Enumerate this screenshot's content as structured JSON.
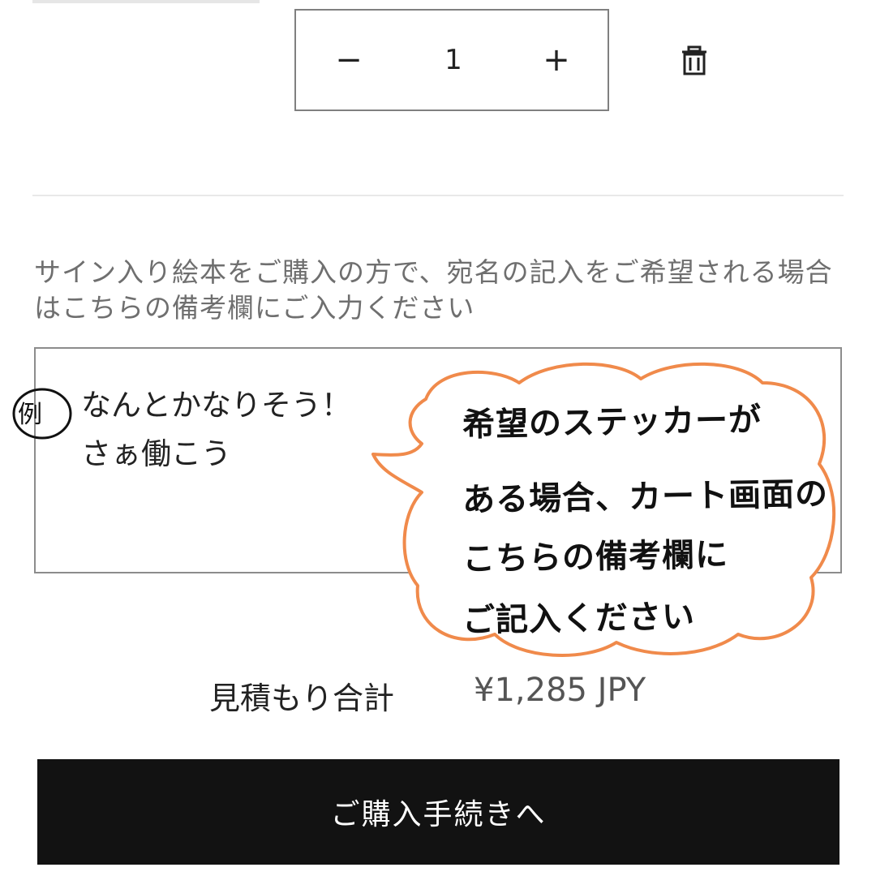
{
  "cart": {
    "quantity": {
      "minus_label": "−",
      "value": "1",
      "plus_label": "+"
    },
    "remove_icon": "trash-icon"
  },
  "note": {
    "label": "サイン入り絵本をご購入の方で、宛名の記入をご希望される場合はこちらの備考欄にご入力ください",
    "value_line1": "なんとかなりそう！",
    "value_line2": "さぁ働こう"
  },
  "annotation": {
    "example_mark": "例",
    "bubble_lines": [
      "希望のステッカーが",
      "ある場合、カート画面の",
      "こちらの備考欄に",
      "ご記入ください"
    ],
    "bubble_border_color": "#f08a4b"
  },
  "summary": {
    "label": "見積もり合計",
    "value": "¥1,285 JPY"
  },
  "checkout": {
    "label": "ご購入手続きへ",
    "color": "#121212"
  }
}
